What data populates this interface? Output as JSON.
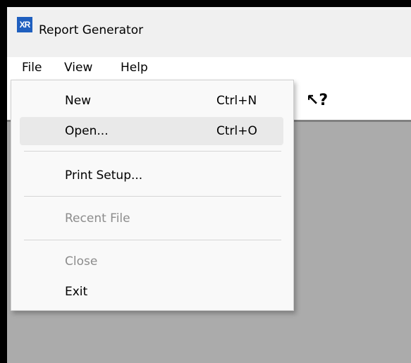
{
  "window": {
    "icon_text": "XR",
    "title": "Report Generator"
  },
  "menubar": {
    "items": [
      "File",
      "View",
      "Help"
    ]
  },
  "toolbar": {
    "help_cursor_icon": "help-pointer-icon",
    "help_cursor_glyph": "↖?"
  },
  "file_menu": {
    "items": [
      {
        "label": "New",
        "shortcut": "Ctrl+N",
        "enabled": true
      },
      {
        "label": "Open...",
        "shortcut": "Ctrl+O",
        "enabled": true,
        "highlighted": true
      },
      {
        "label": "Print Setup...",
        "shortcut": "",
        "enabled": true
      },
      {
        "label": "Recent File",
        "shortcut": "",
        "enabled": false
      },
      {
        "label": "Close",
        "shortcut": "",
        "enabled": false
      },
      {
        "label": "Exit",
        "shortcut": "",
        "enabled": true
      }
    ]
  },
  "colors": {
    "client_area": "#ababab",
    "icon_bg": "#1f5fbf",
    "disabled_text": "#8c8c8c"
  }
}
